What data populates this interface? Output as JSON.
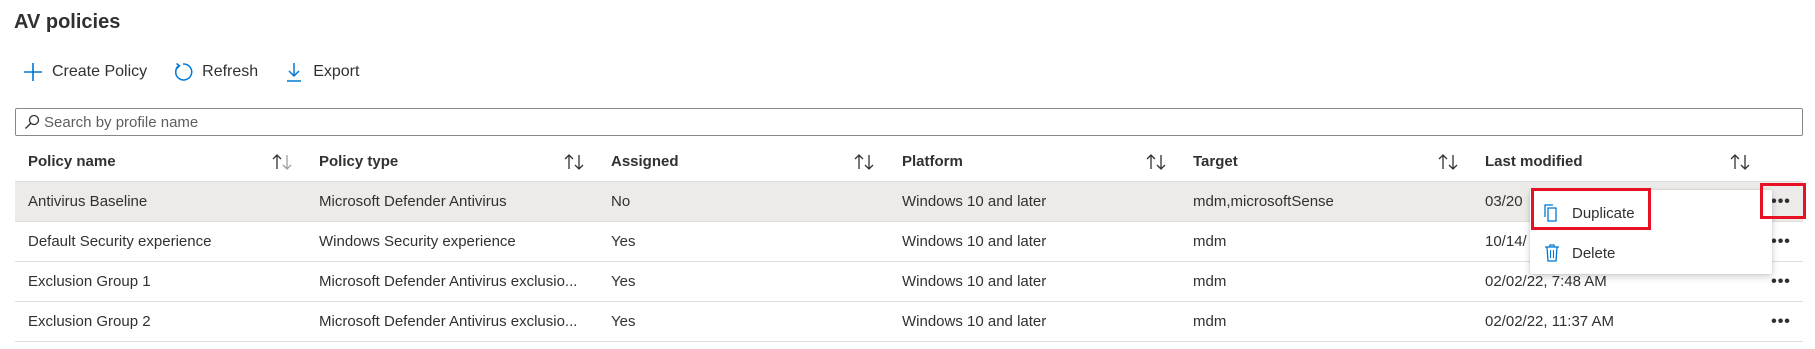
{
  "page": {
    "title": "AV policies"
  },
  "toolbar": {
    "create_label": "Create Policy",
    "refresh_label": "Refresh",
    "export_label": "Export"
  },
  "search": {
    "placeholder": "Search by profile name",
    "value": ""
  },
  "table": {
    "columns": [
      "Policy name",
      "Policy type",
      "Assigned",
      "Platform",
      "Target",
      "Last modified"
    ],
    "rows": [
      [
        "Antivirus Baseline",
        "Microsoft Defender Antivirus",
        "No",
        "Windows 10 and later",
        "mdm,microsoftSense",
        "03/20"
      ],
      [
        "Default Security experience",
        "Windows Security experience",
        "Yes",
        "Windows 10 and later",
        "mdm",
        "10/14/"
      ],
      [
        "Exclusion Group 1",
        "Microsoft Defender Antivirus exclusio...",
        "Yes",
        "Windows 10 and later",
        "mdm",
        "02/02/22, 7:48 AM"
      ],
      [
        "Exclusion Group 2",
        "Microsoft Defender Antivirus exclusio...",
        "Yes",
        "Windows 10 and later",
        "mdm",
        "02/02/22, 11:37 AM"
      ]
    ],
    "more_label": "•••"
  },
  "context_menu": {
    "duplicate_label": "Duplicate",
    "delete_label": "Delete"
  },
  "colors": {
    "accent": "#0078d4",
    "highlight": "#e81123",
    "selected_row": "#edebe9"
  },
  "icons": {
    "create": "plus-icon",
    "refresh": "refresh-icon",
    "export": "download-icon",
    "search": "search-icon",
    "sort": "sort-arrows-icon",
    "more": "more-dots-icon",
    "duplicate": "copy-icon",
    "delete": "trash-icon"
  }
}
